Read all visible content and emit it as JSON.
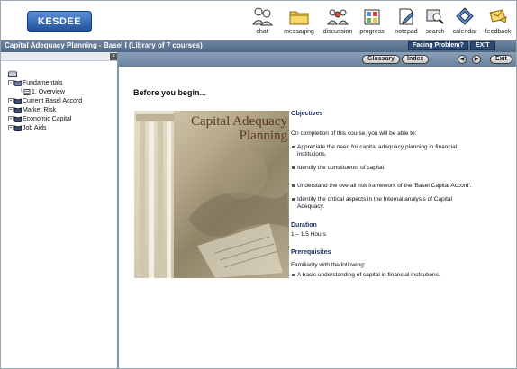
{
  "header": {
    "logo_text": "KESDEE",
    "tools": [
      {
        "label": "chat",
        "icon": "chat-icon"
      },
      {
        "label": "messaging",
        "icon": "folder-icon"
      },
      {
        "label": "discussion",
        "icon": "discussion-icon"
      },
      {
        "label": "progress",
        "icon": "progress-icon"
      },
      {
        "label": "notepad",
        "icon": "notepad-icon"
      },
      {
        "label": "search",
        "icon": "search-icon"
      },
      {
        "label": "calendar",
        "icon": "calendar-icon"
      },
      {
        "label": "feedback",
        "icon": "feedback-icon"
      }
    ]
  },
  "titlebar": {
    "course_title": "Capital Adequacy Planning - Basel I (Library of 7 courses)",
    "facing_problem": "Facing Problem?",
    "exit": "EXIT"
  },
  "tree": {
    "items": [
      {
        "label": "Fundamentals",
        "toggle": "−"
      },
      {
        "label": "1. Overview"
      },
      {
        "label": "Current Basel Accord",
        "toggle": "+"
      },
      {
        "label": "Market Risk",
        "toggle": "+"
      },
      {
        "label": "Economic Capital",
        "toggle": "+"
      },
      {
        "label": "Job Aids",
        "toggle": "+"
      }
    ]
  },
  "navbar": {
    "glossary": "Glossary",
    "index": "Index",
    "exit": "Exit"
  },
  "content": {
    "heading": "Before you begin...",
    "hero_title": "Capital Adequacy Planning",
    "objectives_heading": "Objectives",
    "objectives_intro": "On completion of this course, you will be able to:",
    "objectives": [
      "Appreciate the need for capital adequacy planning in financial institutions.",
      "Identify the constituents of capital.",
      "Understand the overall risk framework of the 'Basel Capital Accord'.",
      "Identify the critical aspects in the Internal analysis of Capital Adequacy."
    ],
    "duration_heading": "Duration",
    "duration_value": "1 – 1.5 Hours",
    "prereq_heading": "Prerequisites",
    "prereq_intro": "Familiarity with the following:",
    "prereqs": [
      "A basic understanding of capital in financial institutions."
    ]
  }
}
